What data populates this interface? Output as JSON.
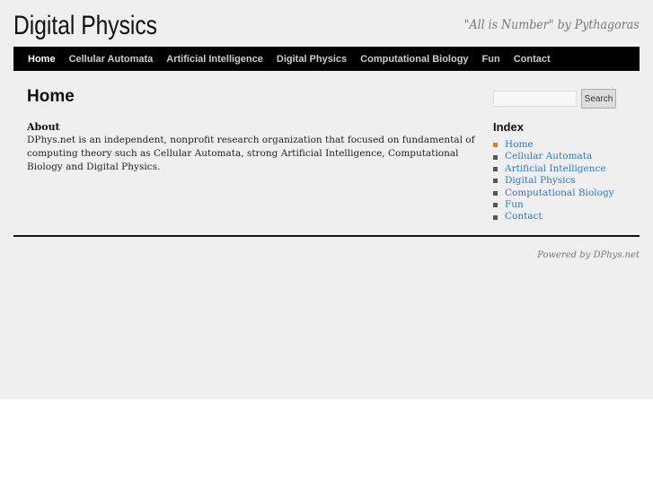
{
  "site": {
    "title": "Digital Physics",
    "tagline": "\"All is Number\" by Pythagoras"
  },
  "nav": [
    {
      "label": "Home"
    },
    {
      "label": "Cellular Automata"
    },
    {
      "label": "Artificial Intelligence"
    },
    {
      "label": "Digital Physics"
    },
    {
      "label": "Computational Biology"
    },
    {
      "label": "Fun"
    },
    {
      "label": "Contact"
    }
  ],
  "main": {
    "heading": "Home",
    "about_heading": "About",
    "about_text": "DPhys.net is an independent, nonprofit research organization that focused on fundamental of computing theory such as Cellular Automata, strong Artificial Intelligence, Computational Biology and Digital Physics."
  },
  "sidebar": {
    "search_value": "",
    "search_button": "Search",
    "index_heading": "Index",
    "items": [
      {
        "label": "Home"
      },
      {
        "label": "Cellular Automata"
      },
      {
        "label": "Artificial Intelligence"
      },
      {
        "label": "Digital Physics"
      },
      {
        "label": "Computational Biology"
      },
      {
        "label": "Fun"
      },
      {
        "label": "Contact"
      }
    ]
  },
  "footer": {
    "powered": "Powered by DPhys.net"
  },
  "colors": {
    "accent": "#f07a10",
    "link": "#2b7bd0",
    "nav_bg": "#000000"
  }
}
